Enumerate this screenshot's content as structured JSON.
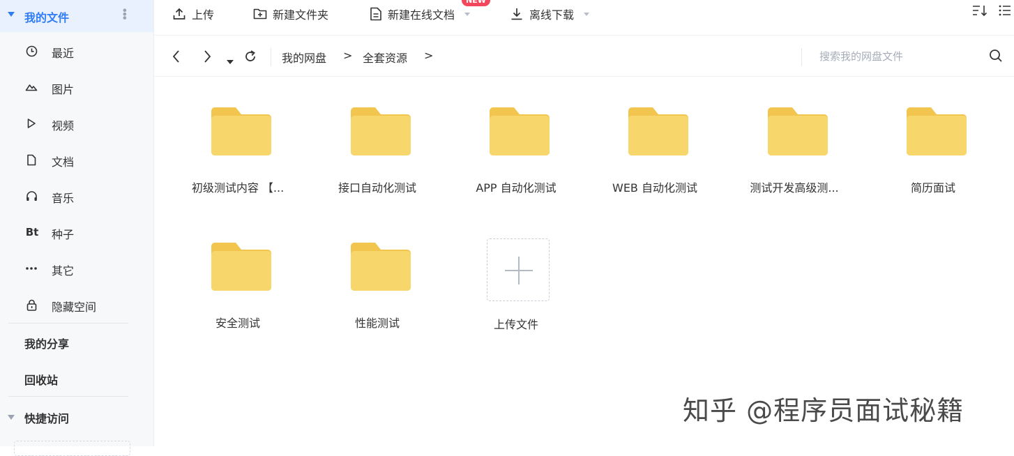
{
  "sidebar": {
    "my_files": "我的文件",
    "items": [
      {
        "label": "最近",
        "icon": "clock-icon"
      },
      {
        "label": "图片",
        "icon": "image-icon"
      },
      {
        "label": "视频",
        "icon": "play-icon"
      },
      {
        "label": "文档",
        "icon": "document-icon"
      },
      {
        "label": "音乐",
        "icon": "headphones-icon"
      },
      {
        "label": "种子",
        "icon": "torrent-icon",
        "glyph": "Bt"
      },
      {
        "label": "其它",
        "icon": "ellipsis-icon"
      },
      {
        "label": "隐藏空间",
        "icon": "lock-icon"
      }
    ],
    "my_share": "我的分享",
    "recycle_bin": "回收站",
    "quick_access": "快捷访问"
  },
  "toolbar": {
    "upload": "上传",
    "new_folder": "新建文件夹",
    "new_online_doc": "新建在线文档",
    "new_badge": "NEW",
    "offline_download": "离线下载"
  },
  "breadcrumb": {
    "root": "我的网盘",
    "separator": ">",
    "current": "全套资源"
  },
  "search": {
    "placeholder": "搜索我的网盘文件"
  },
  "folders": [
    "初级测试内容 【...",
    "接口自动化测试",
    "APP  自动化测试",
    "WEB 自动化测试",
    "测试开发高级测...",
    "简历面试",
    "安全测试",
    "性能测试"
  ],
  "upload_tile": {
    "label": "上传文件"
  },
  "watermark": "知乎 @程序员面试秘籍",
  "colors": {
    "accent": "#2f7cf6",
    "folder": "#f7d56a",
    "folder_tab": "#f2c54e",
    "badge": "#f5475b"
  }
}
